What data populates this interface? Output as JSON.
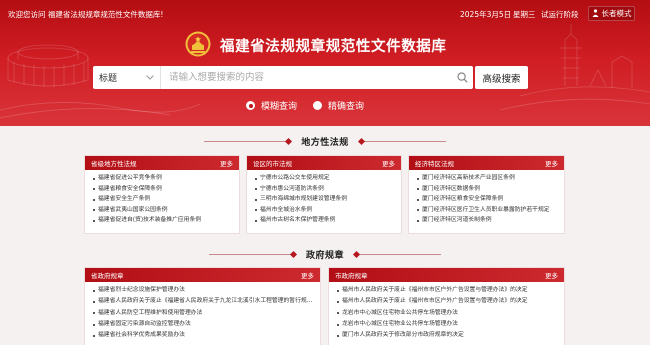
{
  "topbar": {
    "welcome": "欢迎您访问 福建省法规规章规范性文件数据库!",
    "date": "2025年3月5日",
    "weekday": "星期三",
    "status": "试运行阶段",
    "elder_mode": "长者模式"
  },
  "site_title": "福建省法规规章规范性文件数据库",
  "search": {
    "select_value": "标题",
    "placeholder": "请输入想要搜索的内容",
    "advanced_label": "高级搜索"
  },
  "query_modes": [
    {
      "label": "模糊查询",
      "selected": true
    },
    {
      "label": "精确查询",
      "selected": false
    }
  ],
  "sections": {
    "regulations": "地方性法规",
    "rules": "政府规章"
  },
  "cards": {
    "provincial": {
      "title": "省级地方性法规",
      "more": "更多",
      "items": [
        "福建省促进公平竞争条例",
        "福建省粮食安全保障条例",
        "福建省安全生产条例",
        "福建省武夷山国家公园条例",
        "福建省促进自(贸)技术装备推广应用条例"
      ]
    },
    "city": {
      "title": "设区的市法规",
      "more": "更多",
      "items": [
        "宁德市公路公交车使用规定",
        "宁德市惠公河道防洪条例",
        "三明市海绵城市规划建设管理条例",
        "福州市全城治水条例",
        "福州市古树名木保护管理条例"
      ]
    },
    "sez": {
      "title": "经济特区法规",
      "more": "更多",
      "items": [
        "厦门经济特区高新技术产业园区条例",
        "厦门经济特区数据条例",
        "厦门经济特区粮食安全保障条例",
        "厦门经济特区医疗卫生人员职业暴露防护若干规定",
        "厦门经济特区河道长制条例"
      ]
    },
    "prov_rules": {
      "title": "省政府规章",
      "more": "更多",
      "items": [
        "福建省烈士纪念设施保护管理办法",
        "福建省人民政府关于废止《福建省人民政府关于九龙江北溪引水工程管理的暂行规定》的决定",
        "福建省人民防空工程维护和使用管理办法",
        "福建省固定污染源自动监控管理办法",
        "福建省社会科学优秀成果奖励办法"
      ]
    },
    "city_rules": {
      "title": "市政府规章",
      "more": "更多",
      "items": [
        "福州市人民政府关于废止《福州市市区户外广告设置与管理办法》的决定",
        "福州市人民政府关于废止《福州市市区户外广告设置与管理办法》的决定",
        "龙岩市中心城区住宅物业公共停车场管理办法",
        "龙岩市中心城区住宅物业公共停车场管理办法",
        "厦门市人民政府关于修改部分市政府规章的决定"
      ]
    }
  },
  "colors": {
    "primary_red": "#c01218",
    "dark_red": "#a00a0f"
  }
}
